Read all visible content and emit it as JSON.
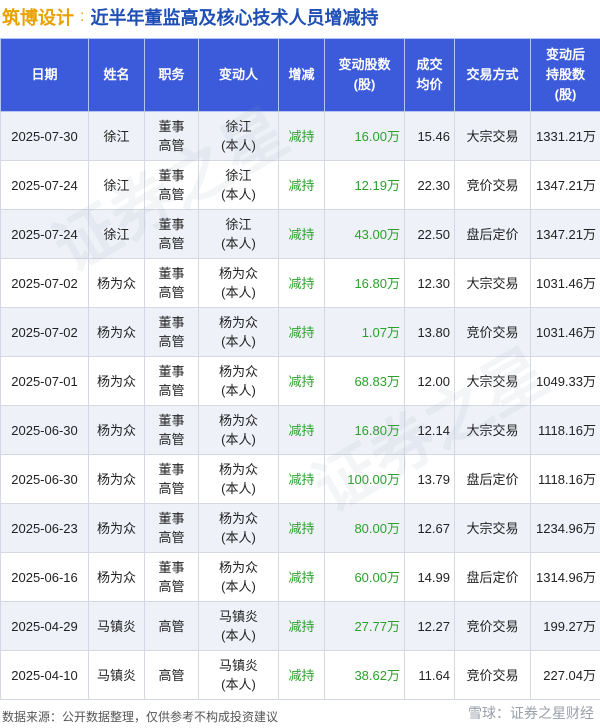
{
  "header": {
    "company": "筑博设计",
    "separator": ":",
    "title": "近半年董监高及核心技术人员增减持"
  },
  "table": {
    "headers": [
      "日期",
      "姓名",
      "职务",
      "变动人",
      "增减",
      "变动股数\n(股)",
      "成交\n均价",
      "交易方式",
      "变动后\n持股数\n(股)"
    ],
    "rows": [
      [
        "2025-07-30",
        "徐江",
        "董事\n高管",
        "徐江\n(本人)",
        "减持",
        "16.00万",
        "15.46",
        "大宗交易",
        "1331.21万"
      ],
      [
        "2025-07-24",
        "徐江",
        "董事\n高管",
        "徐江\n(本人)",
        "减持",
        "12.19万",
        "22.30",
        "竞价交易",
        "1347.21万"
      ],
      [
        "2025-07-24",
        "徐江",
        "董事\n高管",
        "徐江\n(本人)",
        "减持",
        "43.00万",
        "22.50",
        "盘后定价",
        "1347.21万"
      ],
      [
        "2025-07-02",
        "杨为众",
        "董事\n高管",
        "杨为众\n(本人)",
        "减持",
        "16.80万",
        "12.30",
        "大宗交易",
        "1031.46万"
      ],
      [
        "2025-07-02",
        "杨为众",
        "董事\n高管",
        "杨为众\n(本人)",
        "减持",
        "1.07万",
        "13.80",
        "竞价交易",
        "1031.46万"
      ],
      [
        "2025-07-01",
        "杨为众",
        "董事\n高管",
        "杨为众\n(本人)",
        "减持",
        "68.83万",
        "12.00",
        "大宗交易",
        "1049.33万"
      ],
      [
        "2025-06-30",
        "杨为众",
        "董事\n高管",
        "杨为众\n(本人)",
        "减持",
        "16.80万",
        "12.14",
        "大宗交易",
        "1118.16万"
      ],
      [
        "2025-06-30",
        "杨为众",
        "董事\n高管",
        "杨为众\n(本人)",
        "减持",
        "100.00万",
        "13.79",
        "盘后定价",
        "1118.16万"
      ],
      [
        "2025-06-23",
        "杨为众",
        "董事\n高管",
        "杨为众\n(本人)",
        "减持",
        "80.00万",
        "12.67",
        "大宗交易",
        "1234.96万"
      ],
      [
        "2025-06-16",
        "杨为众",
        "董事\n高管",
        "杨为众\n(本人)",
        "减持",
        "60.00万",
        "14.99",
        "盘后定价",
        "1314.96万"
      ],
      [
        "2025-04-29",
        "马镇炎",
        "高管",
        "马镇炎\n(本人)",
        "减持",
        "27.77万",
        "12.27",
        "竞价交易",
        "199.27万"
      ],
      [
        "2025-04-10",
        "马镇炎",
        "高管",
        "马镇炎\n(本人)",
        "减持",
        "38.62万",
        "11.64",
        "竞价交易",
        "227.04万"
      ]
    ]
  },
  "footer": {
    "source": "数据来源：公开数据整理，仅供参考不构成投资建议",
    "brand": "雪球：证券之星财经"
  },
  "watermark": "证券之星",
  "colors": {
    "header_bg": "#3b5bdb",
    "title_blue": "#1f4fb4",
    "company_orange": "#e8a100",
    "reduce_green": "#2aa12a"
  }
}
